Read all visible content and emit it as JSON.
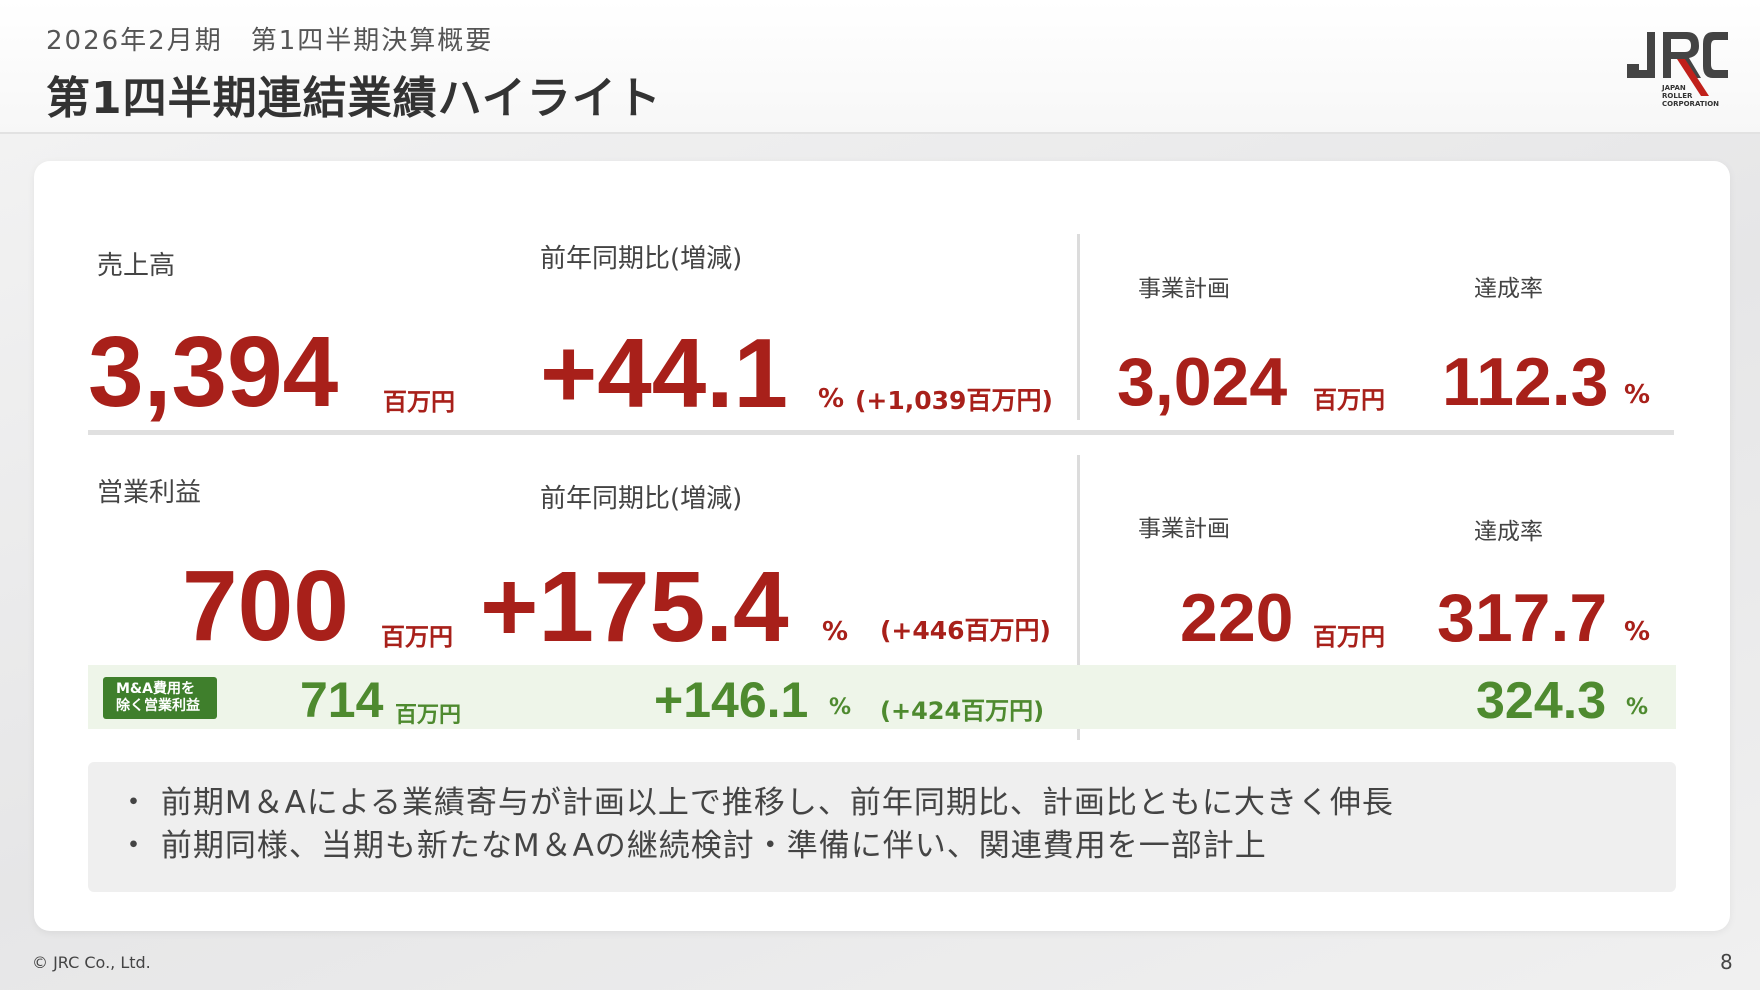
{
  "header": {
    "subtitle": "2026年2月期　第1四半期決算概要",
    "title": "第1四半期連結業績ハイライト",
    "logo_text": [
      "JAPAN",
      "ROLLER",
      "CORPORATION"
    ]
  },
  "colors": {
    "accent_red": "#a8201a",
    "accent_green": "#4e8a2f",
    "badge_green": "#3f7f2c"
  },
  "sales": {
    "label": "売上高",
    "value": "3,394",
    "unit": "百万円",
    "yoy_label": "前年同期比(増減)",
    "yoy_value": "+44.1",
    "yoy_pct": "%",
    "yoy_diff": "(+1,039百万円)",
    "plan_label": "事業計画",
    "plan_value": "3,024",
    "plan_unit": "百万円",
    "rate_label": "達成率",
    "rate_value": "112.3",
    "rate_pct": "%"
  },
  "operating_income": {
    "label": "営業利益",
    "value": "700",
    "unit": "百万円",
    "yoy_label": "前年同期比(増減)",
    "yoy_value": "+175.4",
    "yoy_pct": "%",
    "yoy_diff": "(+446百万円)",
    "plan_label": "事業計画",
    "plan_value": "220",
    "plan_unit": "百万円",
    "rate_label": "達成率",
    "rate_value": "317.7",
    "rate_pct": "%"
  },
  "excl_ma": {
    "badge_line1": "M&A費用を",
    "badge_line2": "除く営業利益",
    "value": "714",
    "unit": "百万円",
    "yoy_value": "+146.1",
    "yoy_pct": "%",
    "yoy_diff": "(+424百万円)",
    "rate_value": "324.3",
    "rate_pct": "%"
  },
  "notes": [
    "・ 前期M＆Aによる業績寄与が計画以上で推移し、前年同期比、計画比ともに大きく伸長",
    "・ 前期同様、当期も新たなM＆Aの継続検討・準備に伴い、関連費用を一部計上"
  ],
  "footer": {
    "copyright": "© JRC Co., Ltd.",
    "page": "8"
  }
}
